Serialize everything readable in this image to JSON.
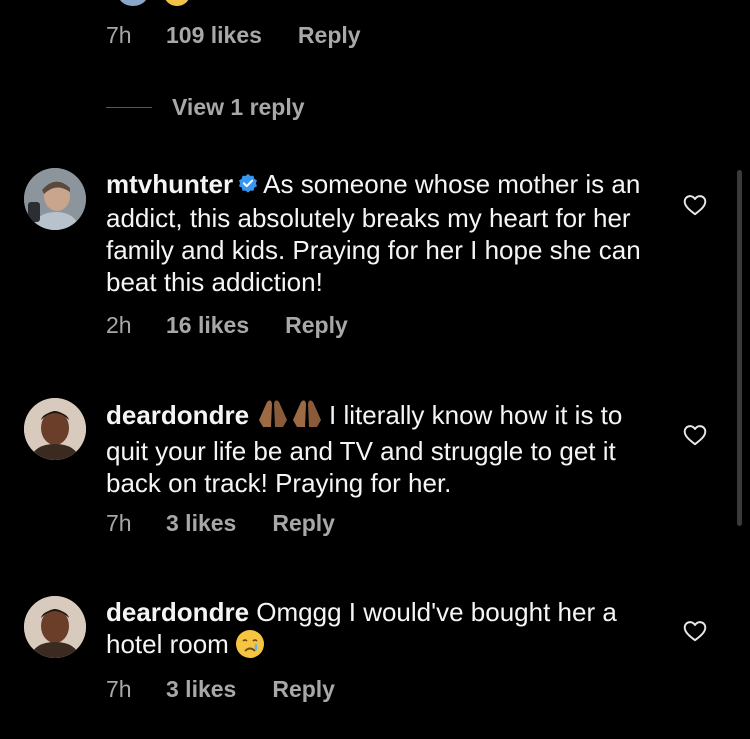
{
  "top": {
    "time": "7h",
    "likes": "109 likes",
    "reply": "Reply",
    "view_replies": "View 1 reply"
  },
  "comments": [
    {
      "username": "mtvhunter",
      "verified": true,
      "text": "As someone whose mother is an addict, this absolutely breaks my heart for her family and kids. Praying for her I hope she can beat this addiction!",
      "time": "2h",
      "likes": "16 likes",
      "reply": "Reply"
    },
    {
      "username": "deardondre",
      "verified": false,
      "text": "I literally know how it is to quit your life be and TV and struggle to get it back on track! Praying for her.",
      "time": "7h",
      "likes": "3 likes",
      "reply": "Reply"
    },
    {
      "username": "deardondre",
      "verified": false,
      "text": "Omggg I would've bought her a hotel room",
      "time": "7h",
      "likes": "3 likes",
      "reply": "Reply"
    }
  ],
  "icons": {
    "verified": "verified-badge-icon",
    "heart": "heart-outline-icon",
    "praying_hands": "folded-hands-emoji",
    "crying": "crying-face-emoji"
  },
  "colors": {
    "background": "#000000",
    "text": "#f5f5f5",
    "secondary": "#a8a8a8",
    "verified": "#3797f0"
  }
}
